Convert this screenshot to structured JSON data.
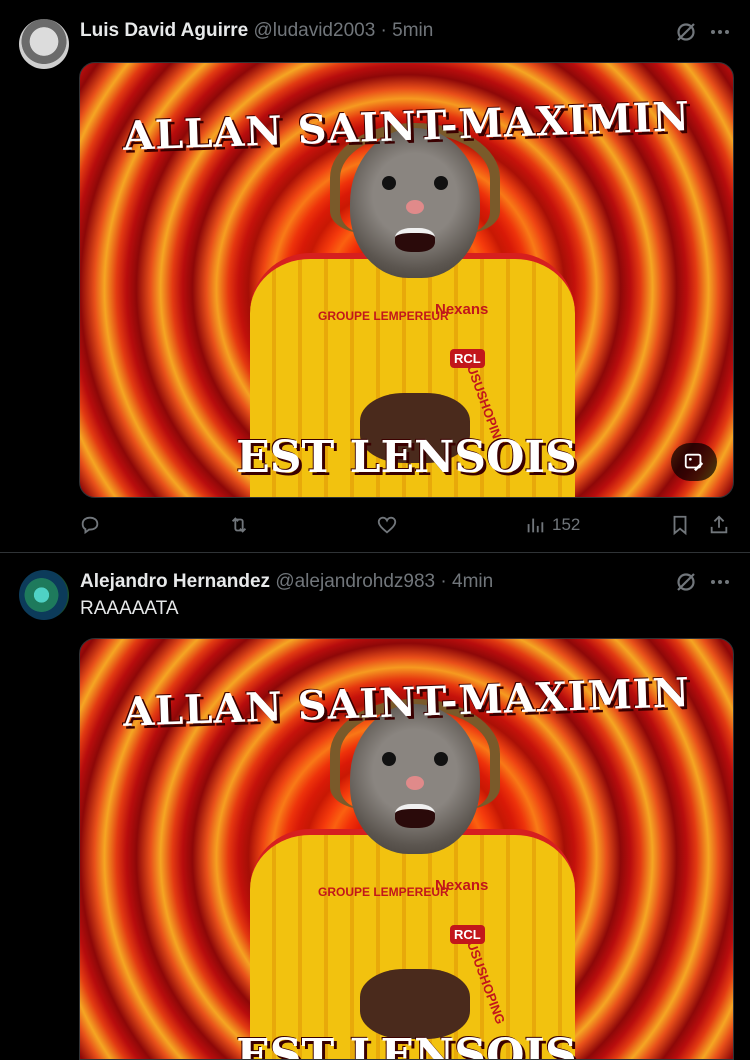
{
  "tweets": [
    {
      "author_name": "Luis David Aguirre",
      "handle": "@ludavid2003",
      "separator": "·",
      "time": "5min",
      "text": "",
      "media": {
        "title": "ALLAN SAINT-MAXIMIN",
        "subtitle": "EST LENSOIS",
        "jersey_sponsor": "GROUPE LEMPEREUR",
        "jersey_brand": "Nexans",
        "jersey_sleeve": "AUSUSHOPING",
        "crest": "RCL"
      },
      "actions": {
        "views": "152"
      }
    },
    {
      "author_name": "Alejandro Hernandez",
      "handle": "@alejandrohdz983",
      "separator": "·",
      "time": "4min",
      "text": "RAAAAATA",
      "media": {
        "title": "ALLAN SAINT-MAXIMIN",
        "subtitle": "EST LENSOIS",
        "jersey_sponsor": "GROUPE LEMPEREUR",
        "jersey_brand": "Nexans",
        "jersey_sleeve": "AUSUSHOPING",
        "crest": "RCL"
      }
    }
  ],
  "icons": {
    "grok": "grok-slash-icon",
    "more": "more-dots-icon",
    "reply": "reply-icon",
    "retweet": "retweet-icon",
    "like": "like-heart-icon",
    "views": "views-bar-icon",
    "bookmark": "bookmark-icon",
    "share": "share-icon",
    "alt_edit": "image-edit-icon"
  },
  "colors": {
    "background": "#000000",
    "text_primary": "#e7e9ea",
    "text_secondary": "#71767b",
    "divider": "#2f3336"
  }
}
